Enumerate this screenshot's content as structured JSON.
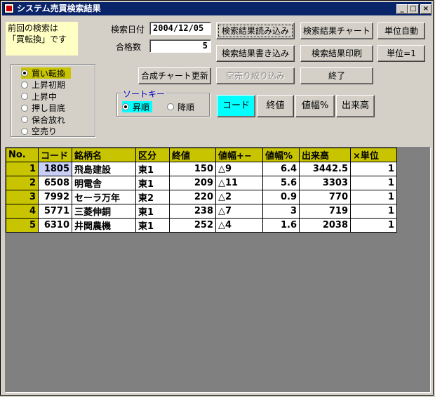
{
  "window": {
    "title": "システム売買検索結果"
  },
  "title_buttons": {
    "minimize": "_",
    "maximize": "□",
    "close": "×"
  },
  "note": {
    "line1": "前回の検索は",
    "line2": "「買転換」です"
  },
  "search": {
    "date_label": "検索日付",
    "date_value": "2004/12/05",
    "count_label": "合格数",
    "count_value": "5"
  },
  "strategies": [
    {
      "label": "買い転換",
      "selected": true
    },
    {
      "label": "上昇初期",
      "selected": false
    },
    {
      "label": "上昇中",
      "selected": false
    },
    {
      "label": "押し目底",
      "selected": false
    },
    {
      "label": "保合放れ",
      "selected": false
    },
    {
      "label": "空売り",
      "selected": false
    }
  ],
  "buttons": {
    "read": "検索結果読み込み",
    "write": "検索結果書き込み",
    "chart": "検索結果チャート",
    "print": "検索結果印刷",
    "unit_auto": "単位自動",
    "unit_one": "単位=1",
    "composite_update": "合成チャート更新",
    "short_filter": "空売り絞り込み",
    "exit": "終了"
  },
  "sort": {
    "title": "ソートキー",
    "asc": "昇順",
    "desc": "降順",
    "selected": "asc",
    "keys": [
      "コード",
      "終値",
      "値幅%",
      "出来高"
    ],
    "active_key": "コード"
  },
  "colors": {
    "title_bar": "#0a246a",
    "header": "#c8c400",
    "active_key": "#00ffff",
    "note": "#ffffc4"
  },
  "table": {
    "columns": [
      "No.",
      "コード",
      "銘柄名",
      "区分",
      "終値",
      "値幅+−",
      "値幅%",
      "出来高",
      "×単位"
    ],
    "rows": [
      [
        "1",
        "1805",
        "飛島建設",
        "東1",
        "150",
        "△9",
        "6.4",
        "3442.5",
        "1"
      ],
      [
        "2",
        "6508",
        "明電舎",
        "東1",
        "209",
        "△11",
        "5.6",
        "3303",
        "1"
      ],
      [
        "3",
        "7992",
        "セーラ万年",
        "東2",
        "220",
        "△2",
        "0.9",
        "770",
        "1"
      ],
      [
        "4",
        "5771",
        "三菱伸銅",
        "東1",
        "238",
        "△7",
        "3",
        "719",
        "1"
      ],
      [
        "5",
        "6310",
        "井関農機",
        "東1",
        "252",
        "△4",
        "1.6",
        "2038",
        "1"
      ]
    ]
  }
}
